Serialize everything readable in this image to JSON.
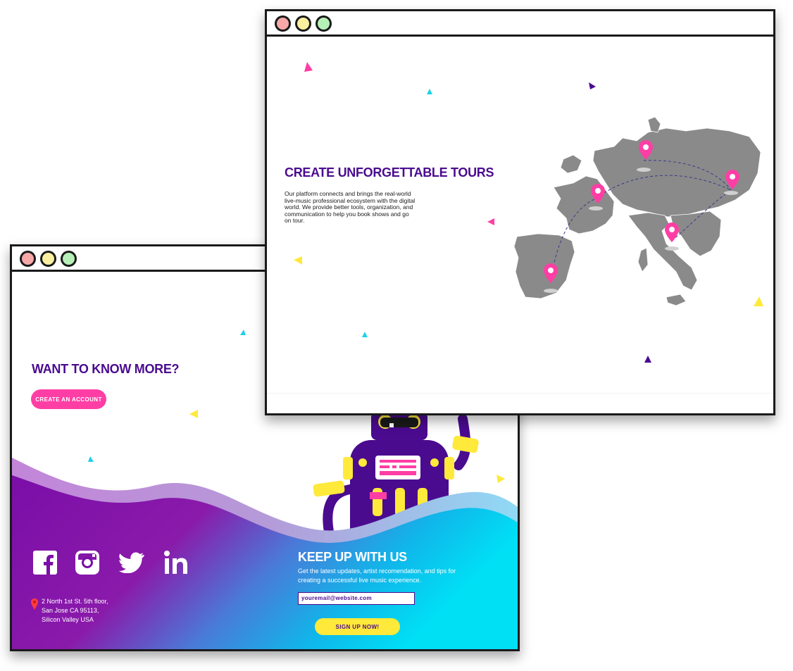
{
  "back_window": {
    "heading": "WANT TO KNOW MORE?",
    "cta_label": "CREATE AN ACCOUNT",
    "social_icons": [
      "facebook-icon",
      "instagram-icon",
      "twitter-icon",
      "linkedin-icon"
    ],
    "address": {
      "line1": "2 North 1st St. 5th floor,",
      "line2": "San Jose CA 95113,",
      "line3": "Silicon Valley USA"
    },
    "newsletter": {
      "title": "KEEP UP WITH US",
      "desc_line1": "Get the latest updates, artist recomendation, and tips for",
      "desc_line2": "creating a successful live music experience.",
      "email_value": "youremail@website.com",
      "signup_label": "SIGN UP NOW!"
    }
  },
  "front_window": {
    "heading": "CREATE UNFORGETTABLE TOURS",
    "desc_lines": [
      "Our platform connects and brings the real-world",
      "live-music professional ecosystem with the digital",
      "world. We provide better tools, organization, and",
      "communication to help you book shows and go",
      "on tour."
    ],
    "map_pins": [
      "berlin-pin",
      "paris-pin",
      "kiev-pin",
      "rome-pin",
      "madrid-pin"
    ]
  },
  "colors": {
    "heading": "#4a0b8f",
    "pink": "#ff3ea5",
    "yellow": "#ffe93a",
    "cyan": "#1fd1e6",
    "purple": "#7a0ea8",
    "map_gray": "#8a8a8a"
  }
}
